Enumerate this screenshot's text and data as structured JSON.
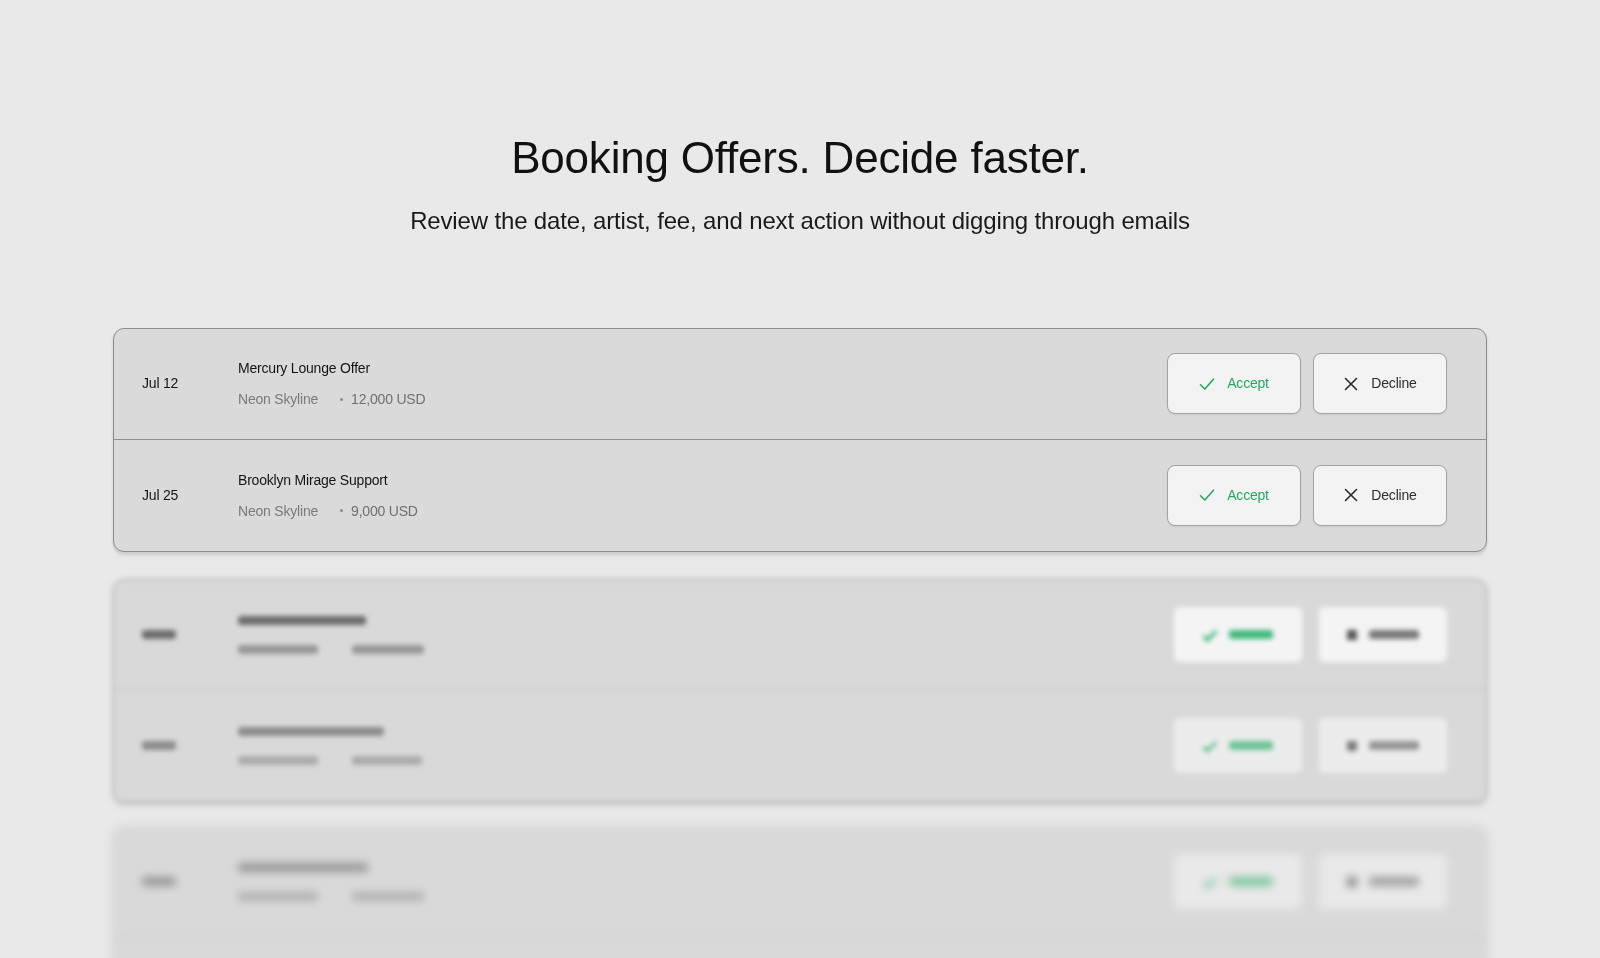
{
  "header": {
    "title": "Booking Offers. Decide faster.",
    "subtitle": "Review the date, artist, fee, and next action without digging through emails"
  },
  "offers": [
    {
      "date": "Jul 12",
      "title": "Mercury Lounge Offer",
      "artist": "Neon Skyline",
      "fee": "12,000 USD",
      "actions": [
        {
          "kind": "accept",
          "label": "Accept"
        },
        {
          "kind": "decline",
          "label": "Decline"
        }
      ]
    },
    {
      "date": "Jul 25",
      "title": "Brooklyn Mirage Support",
      "artist": "Neon Skyline",
      "fee": "9,000 USD",
      "actions": [
        {
          "kind": "accept",
          "label": "Accept"
        },
        {
          "kind": "decline",
          "label": "Decline"
        }
      ]
    }
  ]
}
